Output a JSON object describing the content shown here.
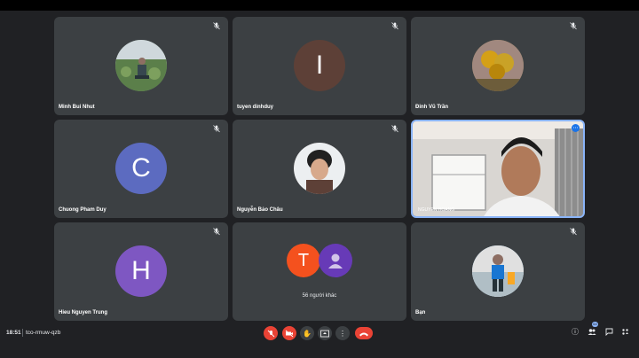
{
  "meeting": {
    "time": "18:51",
    "code": "tco-rmuw-qzb"
  },
  "tiles": [
    {
      "name": "Minh Bui Nhut",
      "avatar_type": "photo-person-field"
    },
    {
      "name": "tuyen dinhduy",
      "avatar_type": "letter",
      "letter": "I",
      "color": "#5d4037"
    },
    {
      "name": "Đinh Vũ Trần",
      "avatar_type": "photo-gold"
    },
    {
      "name": "Chuong Pham Duy",
      "avatar_type": "letter",
      "letter": "C",
      "color": "#5c6bc0"
    },
    {
      "name": "Nguyễn Bảo Châu",
      "avatar_type": "photo-portrait"
    },
    {
      "name": "NGUYEN HOANG",
      "avatar_type": "video"
    },
    {
      "name": "Hieu Nguyen Trung",
      "avatar_type": "letter",
      "letter": "H",
      "color": "#7e57c2"
    },
    {
      "name": "56 người khác",
      "avatar_type": "group",
      "letter": "T",
      "color_a": "#f4511e",
      "color_b": "#673ab7"
    },
    {
      "name": "Bạn",
      "avatar_type": "photo-self"
    }
  ],
  "controls": {
    "mic": "mic-off-icon",
    "camera": "camera-off-icon",
    "raise_hand": "hand-icon",
    "present": "present-icon",
    "more": "more-icon",
    "end": "end-call-icon"
  },
  "right_controls": {
    "info": "info-icon",
    "people": "people-icon",
    "people_count": "64",
    "chat": "chat-icon",
    "activities": "activities-icon"
  }
}
